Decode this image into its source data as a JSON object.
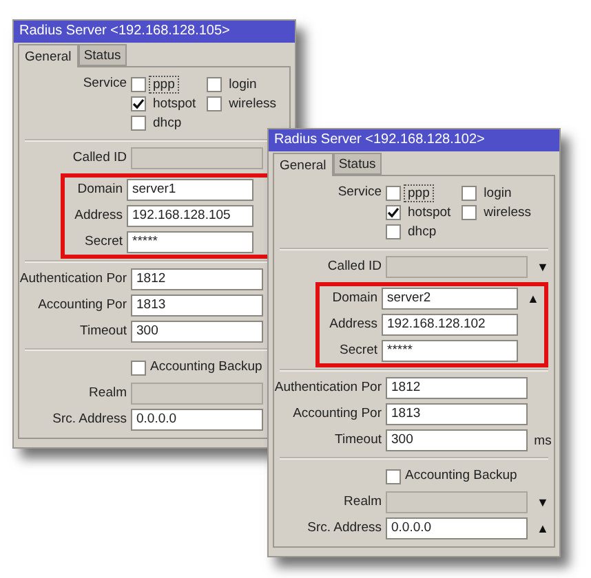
{
  "windows": [
    {
      "title": "Radius Server <192.168.128.105>",
      "tabs": [
        {
          "label": "General",
          "selected": true
        },
        {
          "label": "Status",
          "selected": false
        }
      ],
      "service": {
        "label": "Service",
        "options": [
          {
            "label": "ppp",
            "checked": false,
            "focused": true
          },
          {
            "label": "login",
            "checked": false,
            "focused": false
          },
          {
            "label": "hotspot",
            "checked": true,
            "focused": false
          },
          {
            "label": "wireless",
            "checked": false,
            "focused": false
          },
          {
            "label": "dhcp",
            "checked": false,
            "focused": false
          }
        ]
      },
      "groups": [
        {
          "highlighted": false,
          "rows": [
            {
              "kind": "field",
              "label": "Called ID",
              "value": "",
              "disabled": true
            }
          ]
        },
        {
          "highlighted": true,
          "rows": [
            {
              "kind": "field",
              "label": "Domain",
              "value": "server1",
              "disabled": false
            },
            {
              "kind": "field",
              "label": "Address",
              "value": "192.168.128.105",
              "disabled": false
            },
            {
              "kind": "field",
              "label": "Secret",
              "value": "*****",
              "disabled": false
            }
          ]
        },
        {
          "highlighted": false,
          "rows": [
            {
              "kind": "field",
              "label": "Authentication Por",
              "value": "1812",
              "disabled": false
            },
            {
              "kind": "field",
              "label": "Accounting Por",
              "value": "1813",
              "disabled": false
            },
            {
              "kind": "field",
              "label": "Timeout",
              "value": "300",
              "disabled": false
            }
          ]
        },
        {
          "highlighted": false,
          "rows": [
            {
              "kind": "checkbox",
              "label": "Accounting Backup",
              "checked": false
            },
            {
              "kind": "field",
              "label": "Realm",
              "value": "",
              "disabled": true
            },
            {
              "kind": "field",
              "label": "Src. Address",
              "value": "0.0.0.0",
              "disabled": false
            }
          ]
        }
      ]
    },
    {
      "title": "Radius Server <192.168.128.102>",
      "tabs": [
        {
          "label": "General",
          "selected": true
        },
        {
          "label": "Status",
          "selected": false
        }
      ],
      "service": {
        "label": "Service",
        "options": [
          {
            "label": "ppp",
            "checked": false,
            "focused": true
          },
          {
            "label": "login",
            "checked": false,
            "focused": false
          },
          {
            "label": "hotspot",
            "checked": true,
            "focused": false
          },
          {
            "label": "wireless",
            "checked": false,
            "focused": false
          },
          {
            "label": "dhcp",
            "checked": false,
            "focused": false
          }
        ]
      },
      "groups": [
        {
          "highlighted": false,
          "rows": [
            {
              "kind": "field",
              "label": "Called ID",
              "value": "",
              "disabled": true,
              "arrow": "▼"
            }
          ]
        },
        {
          "highlighted": true,
          "rows": [
            {
              "kind": "field",
              "label": "Domain",
              "value": "server2",
              "disabled": false,
              "arrow": "▲"
            },
            {
              "kind": "field",
              "label": "Address",
              "value": "192.168.128.102",
              "disabled": false
            },
            {
              "kind": "field",
              "label": "Secret",
              "value": "*****",
              "disabled": false
            }
          ]
        },
        {
          "highlighted": false,
          "rows": [
            {
              "kind": "field",
              "label": "Authentication Por",
              "value": "1812",
              "disabled": false
            },
            {
              "kind": "field",
              "label": "Accounting Por",
              "value": "1813",
              "disabled": false
            },
            {
              "kind": "field",
              "label": "Timeout",
              "value": "300",
              "disabled": false,
              "unit": "ms"
            }
          ]
        },
        {
          "highlighted": false,
          "rows": [
            {
              "kind": "checkbox",
              "label": "Accounting Backup",
              "checked": false
            },
            {
              "kind": "field",
              "label": "Realm",
              "value": "",
              "disabled": true,
              "arrow": "▼"
            },
            {
              "kind": "field",
              "label": "Src. Address",
              "value": "0.0.0.0",
              "disabled": false,
              "arrow": "▲"
            }
          ]
        }
      ]
    }
  ]
}
